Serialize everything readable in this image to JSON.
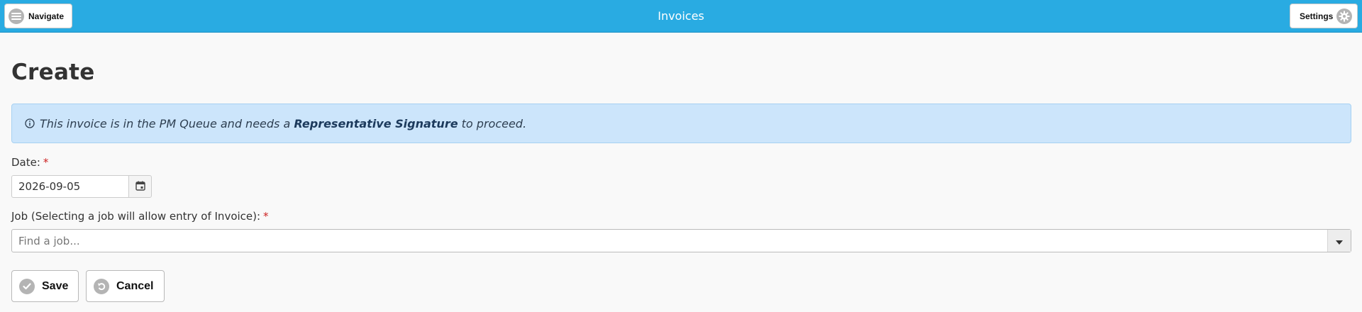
{
  "header": {
    "title": "Invoices",
    "navigate_label": "Navigate",
    "settings_label": "Settings",
    "bar_color": "#29abe2"
  },
  "page": {
    "title": "Create"
  },
  "alert": {
    "text_before": "This invoice is in the PM Queue and needs a ",
    "text_strong": "Representative Signature",
    "text_after": " to proceed.",
    "background_color": "#cce5fb"
  },
  "form": {
    "date_label": "Date:",
    "date_value": "2026-09-05",
    "job_label": "Job (Selecting a job will allow entry of Invoice):",
    "job_placeholder": "Find a job...",
    "required_marker": "*"
  },
  "actions": {
    "save_label": "Save",
    "cancel_label": "Cancel"
  },
  "icons": {
    "navigate": "menu-lines-icon",
    "settings": "gear-icon",
    "alert": "info-circle-icon",
    "date": "calendar-icon",
    "job": "caret-down-icon",
    "save": "check-circle-icon",
    "cancel": "undo-circle-icon"
  }
}
